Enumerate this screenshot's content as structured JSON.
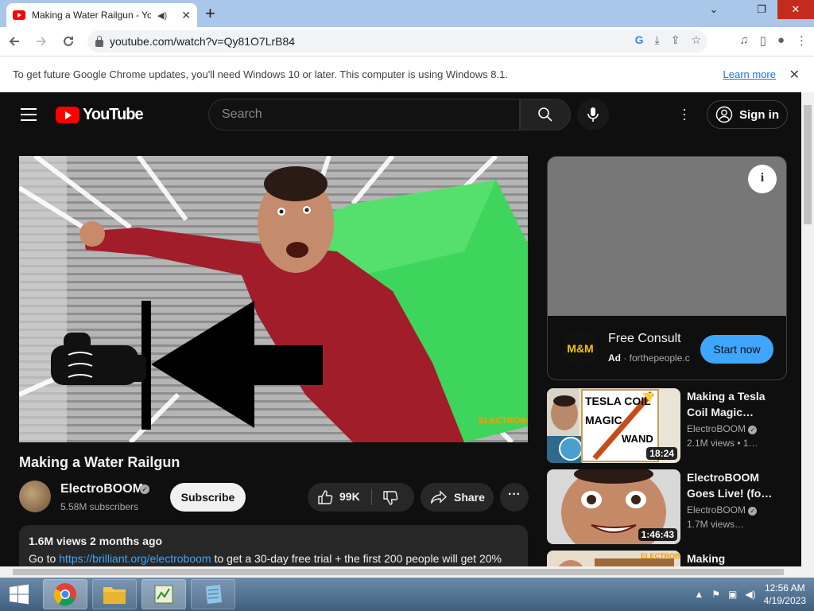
{
  "browser": {
    "tab_title": "Making a Water Railgun - Yo",
    "new_tab_label": "+",
    "url": "youtube.com/watch?v=Qy81O7LrB84",
    "minimize": "⌄",
    "restore": "❐",
    "close": "✕",
    "accent": "#a9c7e8"
  },
  "infobar": {
    "text": "To get future Google Chrome updates, you'll need Windows 10 or later. This computer is using Windows 8.1.",
    "link": "Learn more",
    "close": "✕"
  },
  "youtube": {
    "logo_text": "YouTube",
    "search_placeholder": "Search",
    "sign_in": "Sign in",
    "brand_color": "#ff0000"
  },
  "video": {
    "title": "Making a Water Railgun",
    "watermark": "ELECTROBOOM",
    "channel": "ElectroBOOM",
    "subscribers": "5.58M subscribers",
    "subscribe": "Subscribe",
    "likes": "99K",
    "share": "Share",
    "more": "···",
    "views_age": "1.6M views  2 months ago",
    "desc_prefix": "Go to ",
    "desc_link": "https://brilliant.org/electroboom",
    "desc_suffix": " to get a 30-day free trial + the first 200 people will get 20%"
  },
  "ad": {
    "title": "Free Consult",
    "badge": "Ad",
    "domain": "forthepeople.c",
    "cta": "Start now",
    "logo_text": "M&M",
    "info": "i"
  },
  "recommendations": [
    {
      "title": "Making a Tesla Coil Magic…",
      "channel": "ElectroBOOM",
      "views": "2.1M views • 1…",
      "duration": "18:24",
      "thumb_text": [
        "TESLA COIL",
        "MAGIC",
        "WAND"
      ]
    },
    {
      "title": "ElectroBOOM Goes Live! (fo…",
      "channel": "ElectroBOOM",
      "views": "1.7M views…",
      "duration": "1:46:43"
    },
    {
      "title": "Making",
      "thumb_text": "ELECTROBOOM"
    }
  ],
  "taskbar": {
    "time": "12:56 AM",
    "date": "4/19/2023"
  }
}
